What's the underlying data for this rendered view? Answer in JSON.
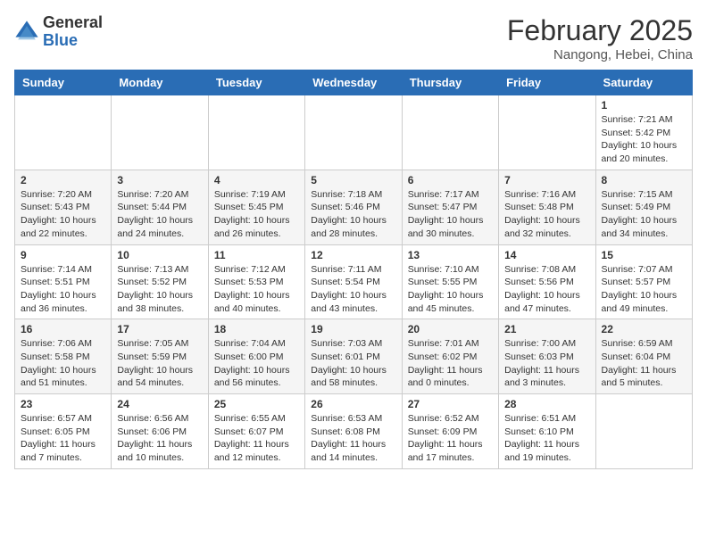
{
  "header": {
    "logo_general": "General",
    "logo_blue": "Blue",
    "month_title": "February 2025",
    "subtitle": "Nangong, Hebei, China"
  },
  "days_of_week": [
    "Sunday",
    "Monday",
    "Tuesday",
    "Wednesday",
    "Thursday",
    "Friday",
    "Saturday"
  ],
  "weeks": [
    [
      {
        "day": "",
        "info": ""
      },
      {
        "day": "",
        "info": ""
      },
      {
        "day": "",
        "info": ""
      },
      {
        "day": "",
        "info": ""
      },
      {
        "day": "",
        "info": ""
      },
      {
        "day": "",
        "info": ""
      },
      {
        "day": "1",
        "info": "Sunrise: 7:21 AM\nSunset: 5:42 PM\nDaylight: 10 hours and 20 minutes."
      }
    ],
    [
      {
        "day": "2",
        "info": "Sunrise: 7:20 AM\nSunset: 5:43 PM\nDaylight: 10 hours and 22 minutes."
      },
      {
        "day": "3",
        "info": "Sunrise: 7:20 AM\nSunset: 5:44 PM\nDaylight: 10 hours and 24 minutes."
      },
      {
        "day": "4",
        "info": "Sunrise: 7:19 AM\nSunset: 5:45 PM\nDaylight: 10 hours and 26 minutes."
      },
      {
        "day": "5",
        "info": "Sunrise: 7:18 AM\nSunset: 5:46 PM\nDaylight: 10 hours and 28 minutes."
      },
      {
        "day": "6",
        "info": "Sunrise: 7:17 AM\nSunset: 5:47 PM\nDaylight: 10 hours and 30 minutes."
      },
      {
        "day": "7",
        "info": "Sunrise: 7:16 AM\nSunset: 5:48 PM\nDaylight: 10 hours and 32 minutes."
      },
      {
        "day": "8",
        "info": "Sunrise: 7:15 AM\nSunset: 5:49 PM\nDaylight: 10 hours and 34 minutes."
      }
    ],
    [
      {
        "day": "9",
        "info": "Sunrise: 7:14 AM\nSunset: 5:51 PM\nDaylight: 10 hours and 36 minutes."
      },
      {
        "day": "10",
        "info": "Sunrise: 7:13 AM\nSunset: 5:52 PM\nDaylight: 10 hours and 38 minutes."
      },
      {
        "day": "11",
        "info": "Sunrise: 7:12 AM\nSunset: 5:53 PM\nDaylight: 10 hours and 40 minutes."
      },
      {
        "day": "12",
        "info": "Sunrise: 7:11 AM\nSunset: 5:54 PM\nDaylight: 10 hours and 43 minutes."
      },
      {
        "day": "13",
        "info": "Sunrise: 7:10 AM\nSunset: 5:55 PM\nDaylight: 10 hours and 45 minutes."
      },
      {
        "day": "14",
        "info": "Sunrise: 7:08 AM\nSunset: 5:56 PM\nDaylight: 10 hours and 47 minutes."
      },
      {
        "day": "15",
        "info": "Sunrise: 7:07 AM\nSunset: 5:57 PM\nDaylight: 10 hours and 49 minutes."
      }
    ],
    [
      {
        "day": "16",
        "info": "Sunrise: 7:06 AM\nSunset: 5:58 PM\nDaylight: 10 hours and 51 minutes."
      },
      {
        "day": "17",
        "info": "Sunrise: 7:05 AM\nSunset: 5:59 PM\nDaylight: 10 hours and 54 minutes."
      },
      {
        "day": "18",
        "info": "Sunrise: 7:04 AM\nSunset: 6:00 PM\nDaylight: 10 hours and 56 minutes."
      },
      {
        "day": "19",
        "info": "Sunrise: 7:03 AM\nSunset: 6:01 PM\nDaylight: 10 hours and 58 minutes."
      },
      {
        "day": "20",
        "info": "Sunrise: 7:01 AM\nSunset: 6:02 PM\nDaylight: 11 hours and 0 minutes."
      },
      {
        "day": "21",
        "info": "Sunrise: 7:00 AM\nSunset: 6:03 PM\nDaylight: 11 hours and 3 minutes."
      },
      {
        "day": "22",
        "info": "Sunrise: 6:59 AM\nSunset: 6:04 PM\nDaylight: 11 hours and 5 minutes."
      }
    ],
    [
      {
        "day": "23",
        "info": "Sunrise: 6:57 AM\nSunset: 6:05 PM\nDaylight: 11 hours and 7 minutes."
      },
      {
        "day": "24",
        "info": "Sunrise: 6:56 AM\nSunset: 6:06 PM\nDaylight: 11 hours and 10 minutes."
      },
      {
        "day": "25",
        "info": "Sunrise: 6:55 AM\nSunset: 6:07 PM\nDaylight: 11 hours and 12 minutes."
      },
      {
        "day": "26",
        "info": "Sunrise: 6:53 AM\nSunset: 6:08 PM\nDaylight: 11 hours and 14 minutes."
      },
      {
        "day": "27",
        "info": "Sunrise: 6:52 AM\nSunset: 6:09 PM\nDaylight: 11 hours and 17 minutes."
      },
      {
        "day": "28",
        "info": "Sunrise: 6:51 AM\nSunset: 6:10 PM\nDaylight: 11 hours and 19 minutes."
      },
      {
        "day": "",
        "info": ""
      }
    ]
  ]
}
